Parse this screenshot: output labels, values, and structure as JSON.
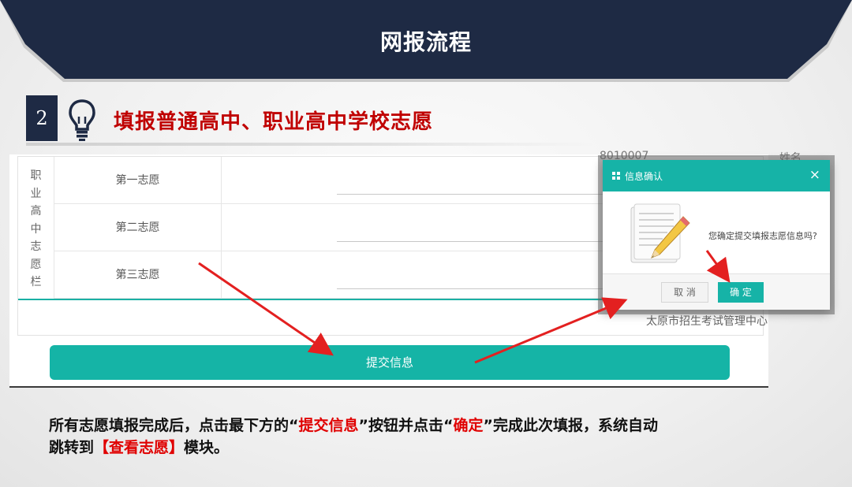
{
  "banner": {
    "title": "网报流程"
  },
  "step": {
    "number": "2",
    "title": "填报普通高中、职业高中学校志愿",
    "icon": "lightbulb-icon"
  },
  "form": {
    "section_label": [
      "职",
      "业",
      "高",
      "中",
      "志",
      "愿",
      "栏"
    ],
    "rows": [
      {
        "label": "第一志愿"
      },
      {
        "label": "第二志愿"
      },
      {
        "label": "第三志愿"
      }
    ],
    "agency": "太原市招生考试管理中心",
    "submit_label": "提交信息"
  },
  "background_fragments": {
    "top_number": "8010007",
    "name_label": "姓名"
  },
  "dialog": {
    "title": "信息确认",
    "close": "×",
    "message": "您确定提交填报志愿信息吗?",
    "cancel_label": "取 消",
    "ok_label": "确 定"
  },
  "caption": {
    "line1_a": "所有志愿填报完成后，点击最下方的“",
    "line1_b": "提交信息",
    "line1_c": "”按钮并点击“",
    "line1_d": "确定",
    "line1_e": "”完成此次填报，系统自动",
    "line2_a": "跳转到",
    "line2_b": "【查看志愿】",
    "line2_c": "模块。"
  },
  "colors": {
    "banner": "#1e2a44",
    "accent_red": "#c00000",
    "teal": "#15b4a6",
    "arrow_red": "#e32020"
  }
}
